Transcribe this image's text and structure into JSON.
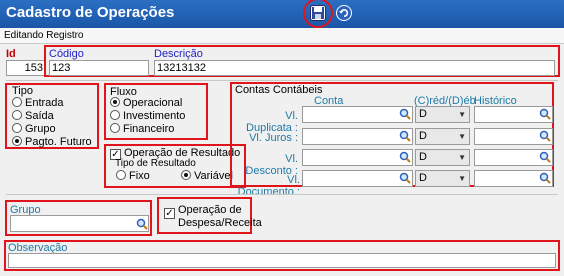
{
  "window": {
    "title": "Cadastro de Operações"
  },
  "subtab": {
    "label": "Editando Registro"
  },
  "header": {
    "id_label": "Id",
    "id_value": "153",
    "codigo_label": "Código",
    "codigo_value": "123",
    "descricao_label": "Descrição",
    "descricao_value": "13213132"
  },
  "tipo": {
    "label": "Tipo",
    "options": [
      "Entrada",
      "Saída",
      "Grupo",
      "Pagto. Futuro"
    ],
    "selected": "Pagto. Futuro"
  },
  "fluxo": {
    "label": "Fluxo",
    "options": [
      "Operacional",
      "Investimento",
      "Financeiro"
    ],
    "selected": "Operacional"
  },
  "resultado": {
    "check_label": "Operação de Resultado",
    "checked": true,
    "tipo_label": "Tipo de Resultado",
    "options": [
      "Fixo",
      "Variável"
    ],
    "selected": "Variável"
  },
  "contas": {
    "title": "Contas Contábeis",
    "col_conta": "Conta",
    "col_cd": "(C)réd/(D)éb",
    "col_historico": "Histórico",
    "rows": [
      {
        "label": "Vl. Duplicata :",
        "cd": "D"
      },
      {
        "label": "Vl. Juros :",
        "cd": "D"
      },
      {
        "label": "Vl. Desconto :",
        "cd": "D"
      },
      {
        "label": "Vl. Documento :",
        "cd": "D"
      }
    ]
  },
  "grupo": {
    "label": "Grupo",
    "value": ""
  },
  "despesa": {
    "label_line1": "Operação de",
    "label_line2": "Despesa/Receita",
    "checked": true
  },
  "observacao": {
    "label": "Observação",
    "value": ""
  },
  "colors": {
    "titlebar": "#1a56a8",
    "highlight": "#e0151b"
  }
}
